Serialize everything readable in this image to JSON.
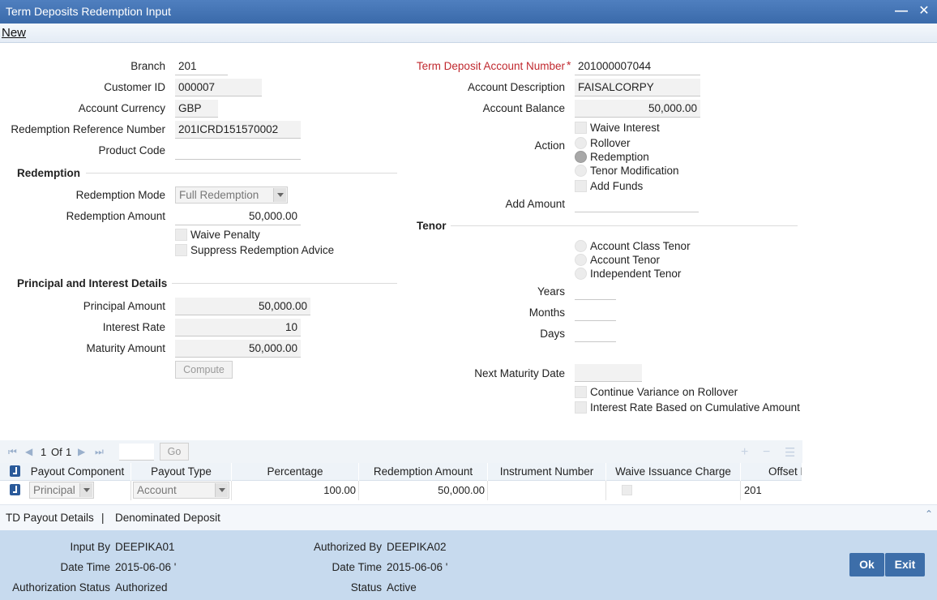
{
  "window": {
    "title": "Term Deposits Redemption Input"
  },
  "menu": {
    "new_label": "New"
  },
  "left": {
    "branch_label": "Branch",
    "branch": "201",
    "customer_label": "Customer ID",
    "customer": "000007",
    "currency_label": "Account Currency",
    "currency": "GBP",
    "redref_label": "Redemption Reference Number",
    "redref": "201ICRD151570002",
    "product_label": "Product Code",
    "product": ""
  },
  "right": {
    "td_acc_label": "Term Deposit Account Number",
    "td_acc": "201000007044",
    "desc_label": "Account Description",
    "desc": "FAISALCORPY",
    "balance_label": "Account Balance",
    "balance": "50,000.00",
    "waive_interest": "Waive Interest",
    "action_label": "Action",
    "action_options": [
      "Rollover",
      "Redemption",
      "Tenor Modification"
    ],
    "action_selected": "Redemption",
    "add_funds": "Add Funds",
    "add_amount_label": "Add Amount",
    "add_amount": ""
  },
  "redemption": {
    "section_title": "Redemption",
    "mode_label": "Redemption Mode",
    "mode": "Full Redemption",
    "amount_label": "Redemption Amount",
    "amount": "50,000.00",
    "waive_penalty": "Waive Penalty",
    "suppress_advice": "Suppress Redemption Advice"
  },
  "principal": {
    "section_title": "Principal and Interest Details",
    "principal_label": "Principal Amount",
    "principal": "50,000.00",
    "rate_label": "Interest Rate",
    "rate": "10",
    "maturity_label": "Maturity Amount",
    "maturity": "50,000.00",
    "compute_label": "Compute"
  },
  "tenor": {
    "section_title": "Tenor",
    "options": [
      "Account Class Tenor",
      "Account Tenor",
      "Independent Tenor"
    ],
    "years_label": "Years",
    "months_label": "Months",
    "days_label": "Days",
    "next_maturity_label": "Next Maturity Date",
    "continue_variance": "Continue Variance on Rollover",
    "rate_cumulative": "Interest Rate Based on Cumulative Amount"
  },
  "grid": {
    "page_current": "1",
    "page_of": "Of",
    "page_total": "1",
    "go_label": "Go",
    "columns": [
      "Payout Component",
      "Payout Type",
      "Percentage",
      "Redemption Amount",
      "Instrument Number",
      "Waive Issuance Charge",
      "Offset B"
    ],
    "row": {
      "component": "Principal",
      "type": "Account",
      "percentage": "100.00",
      "amount": "50,000.00",
      "instrument": "",
      "offset": "201"
    }
  },
  "tabs": {
    "payout": "TD Payout Details",
    "separator": "|",
    "denominated": "Denominated Deposit"
  },
  "footer": {
    "input_by_label": "Input By",
    "input_by": "DEEPIKA01",
    "date1_label": "Date Time",
    "date1": "2015-06-06 '",
    "auth_status_label": "Authorization Status",
    "auth_status": "Authorized",
    "auth_by_label": "Authorized By",
    "auth_by": "DEEPIKA02",
    "date2_label": "Date Time",
    "date2": "2015-06-06 '",
    "status_label": "Status",
    "status": "Active",
    "ok_label": "Ok",
    "exit_label": "Exit"
  },
  "colors": {
    "title_bar": "#3a6aaa",
    "footer_bg": "#c7daee",
    "required": "#c0282e",
    "button": "#3d6ea9"
  }
}
